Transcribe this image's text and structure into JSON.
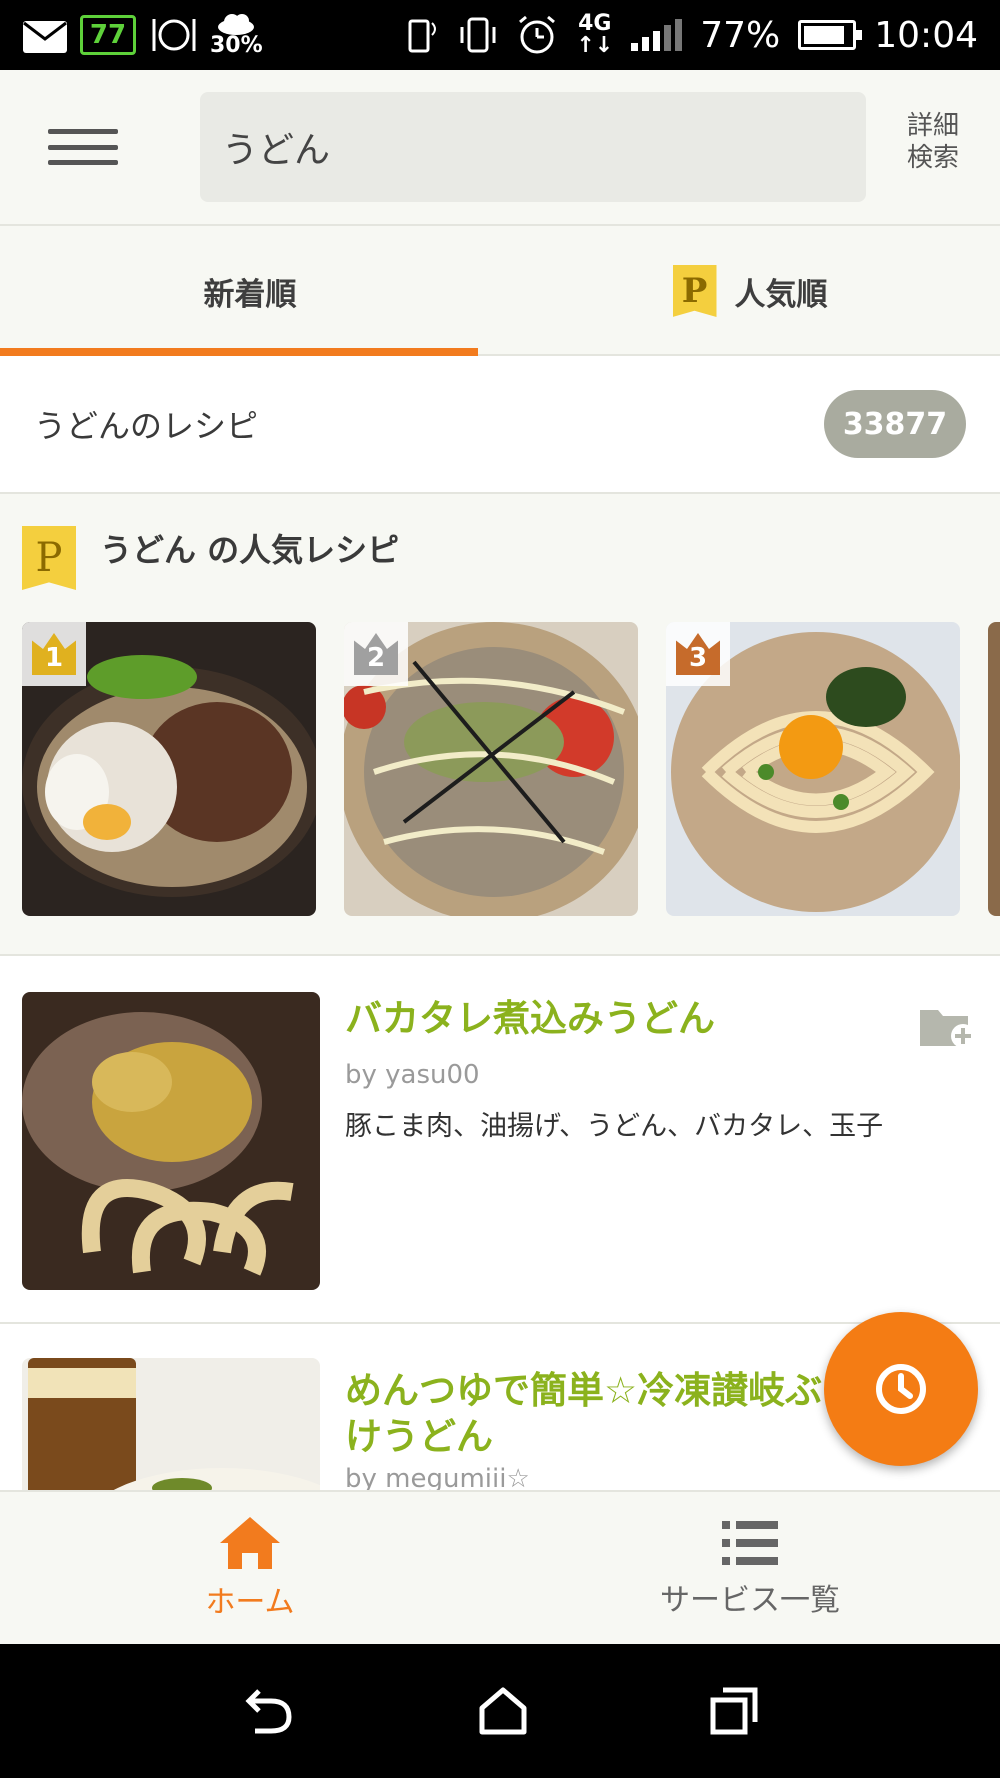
{
  "status_bar": {
    "weather_percent": "30%",
    "network": "4G",
    "green_badge": "77",
    "battery_percent": "77%",
    "time": "10:04"
  },
  "header": {
    "search_value": "うどん",
    "advanced_search_label": "詳細検索"
  },
  "tabs": [
    {
      "label": "新着順",
      "active": true
    },
    {
      "label": "人気順",
      "badge": "P",
      "active": false
    }
  ],
  "recipe_count": {
    "label": "うどんのレシピ",
    "count": "33877"
  },
  "popular": {
    "badge": "P",
    "title": "うどん の人気レシピ",
    "items": [
      {
        "rank": "1",
        "rank_color": "#e0b11f"
      },
      {
        "rank": "2",
        "rank_color": "#a0a0a0"
      },
      {
        "rank": "3",
        "rank_color": "#c66b2b"
      }
    ]
  },
  "recipes": [
    {
      "title": "バカタレ煮込みうどん",
      "author": "by yasu00",
      "ingredients": "豚こま肉、油揚げ、うどん、バカタレ、玉子"
    },
    {
      "title": "めんつゆで簡単☆冷凍讃岐ぶっかけうどん",
      "author": "by megumiii☆"
    }
  ],
  "bottom_nav": {
    "home_label": "ホーム",
    "services_label": "サービス一覧"
  },
  "colors": {
    "accent": "#f27b1e",
    "title_green": "#8bb21d",
    "badge_gray": "#a9ab9f",
    "premium_yellow": "#f4cf3e"
  }
}
